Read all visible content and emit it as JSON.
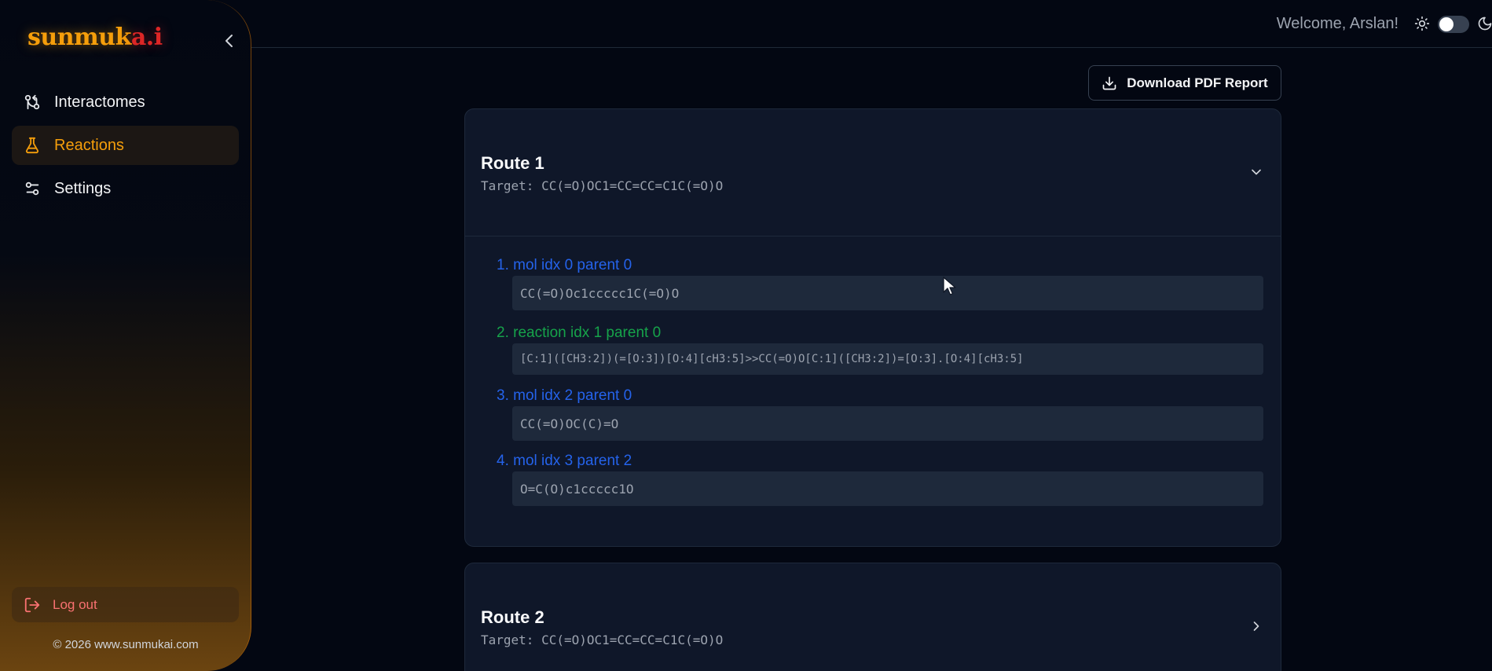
{
  "brand": {
    "name_main": "sunmuk",
    "name_accent": "a.i"
  },
  "sidebar": {
    "items": [
      {
        "label": "Interactomes",
        "icon": "workflow-icon"
      },
      {
        "label": "Reactions",
        "icon": "flask-icon",
        "active": true
      },
      {
        "label": "Settings",
        "icon": "sliders-icon"
      }
    ],
    "logout_label": "Log out",
    "copyright": "© 2026 www.sunmukai.com"
  },
  "header": {
    "welcome": "Welcome, Arslan!",
    "theme_toggle": "light"
  },
  "actions": {
    "download_label": "Download PDF Report"
  },
  "routes": [
    {
      "title": "Route 1",
      "target": "Target: CC(=O)OC1=CC=CC=C1C(=O)O",
      "expanded": true,
      "steps": [
        {
          "label": "1. mol idx 0 parent 0",
          "kind": "mol",
          "code": "CC(=O)Oc1ccccc1C(=O)O"
        },
        {
          "label": "2. reaction idx 1 parent 0",
          "kind": "reaction",
          "code": "[C:1]([CH3:2])(=[O:3])[O:4][cH3:5]>>CC(=O)O[C:1]([CH3:2])=[O:3].[O:4][cH3:5]"
        },
        {
          "label": "3. mol idx 2 parent 0",
          "kind": "mol",
          "code": "CC(=O)OC(C)=O"
        },
        {
          "label": "4. mol idx 3 parent 2",
          "kind": "mol",
          "code": "O=C(O)c1ccccc1O"
        }
      ]
    },
    {
      "title": "Route 2",
      "target": "Target: CC(=O)OC1=CC=CC=C1C(=O)O",
      "expanded": false
    }
  ],
  "colors": {
    "accent": "#f59e0b",
    "mol_step": "#2563eb",
    "reaction_step": "#16a34a",
    "logout": "#f87171"
  }
}
